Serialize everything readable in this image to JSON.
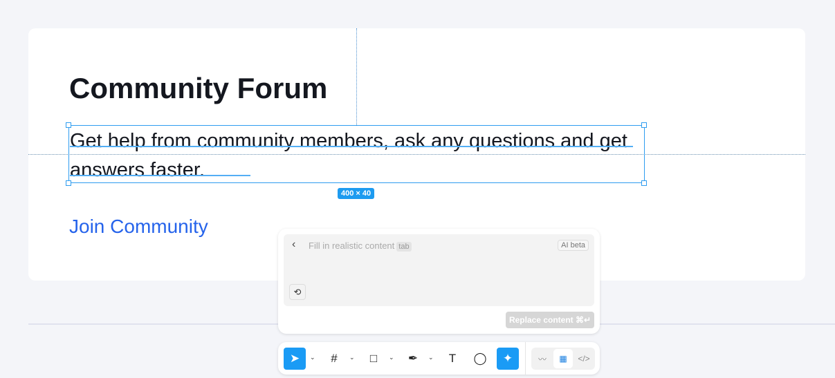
{
  "page": {
    "title": "Community Forum",
    "description": "Get help from community members, ask any questions and get answers faster.",
    "link": "Join Community"
  },
  "selection": {
    "size": "400 × 40"
  },
  "ai_panel": {
    "back": "‹",
    "placeholder": "Fill in realistic content",
    "tab_hint": "tab",
    "badge": "AI beta",
    "history": "⟲",
    "replace": "Replace content ⌘↵"
  },
  "toolbar": {
    "move": "➤",
    "frame": "#",
    "rect": "□",
    "pen": "✒",
    "text": "T",
    "comment": "◯",
    "ai": "✦",
    "chevron": "⌄",
    "draw": "〰",
    "design": "▦",
    "code": "</>"
  }
}
